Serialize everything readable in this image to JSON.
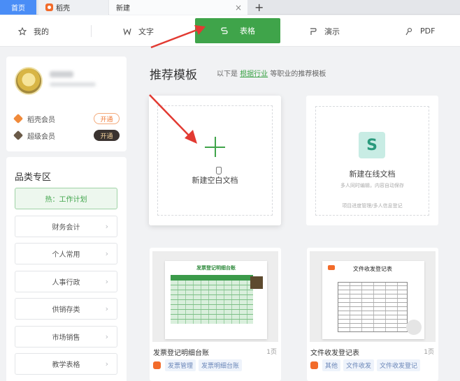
{
  "tabs": {
    "home": "首页",
    "docer": "稻壳",
    "new_tab": "新建",
    "close_glyph": "×",
    "plus_glyph": "+"
  },
  "nav": {
    "mine": "我的",
    "writer": "文字",
    "sheet": "表格",
    "present": "演示",
    "pdf": "PDF",
    "icons": {
      "mine": "star-icon",
      "writer": "writer-w-icon",
      "sheet": "sheet-s-icon",
      "present": "present-p-icon",
      "pdf": "pdf-icon"
    },
    "active_color": "#3fa44a"
  },
  "user": {
    "memberships": [
      {
        "label": "稻壳会员",
        "button": "开通"
      },
      {
        "label": "超级会员",
        "button": "开通"
      }
    ]
  },
  "categories": {
    "title": "品类专区",
    "items": [
      "热：工作计划",
      "财务会计",
      "个人常用",
      "人事行政",
      "供销存类",
      "市场销售",
      "教学表格"
    ],
    "chevron": "›"
  },
  "main": {
    "title": "推荐模板",
    "subtitle_prefix": "以下是",
    "subtitle_link": "根据行业",
    "subtitle_suffix": "等职业的推荐模板",
    "blank_card": {
      "label": "新建空白文档"
    },
    "online_card": {
      "icon_letter": "S",
      "title": "新建在线文档",
      "desc": "多人同时编辑，内容自动保存",
      "tags": "项目进度管理/多人信息登记"
    },
    "templates": [
      {
        "thumb_title": "发票登记明细台账",
        "name": "发票登记明细台账",
        "pages": "1页",
        "tags": [
          "发票管理",
          "发票明细台账"
        ]
      },
      {
        "thumb_title": "文件收发登记表",
        "name": "文件收发登记表",
        "pages": "1页",
        "tags": [
          "其他",
          "文件收发",
          "文件收发登记"
        ]
      }
    ]
  },
  "colors": {
    "accent_green": "#3fa44a",
    "home_tab_blue": "#4a8df6",
    "arrow_red": "#e23a32"
  }
}
